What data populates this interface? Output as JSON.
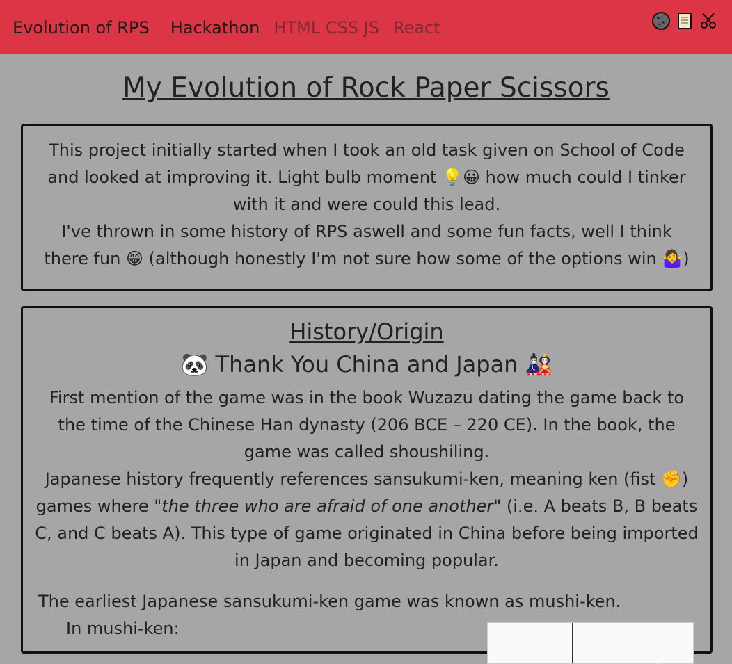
{
  "navbar": {
    "brand": "Evolution of RPS",
    "links": [
      "Hackathon",
      "HTML CSS JS",
      "React"
    ],
    "icons": [
      "rock-icon",
      "paper-icon",
      "scissors-icon"
    ]
  },
  "title": "My Evolution of Rock Paper Scissors",
  "intro": {
    "line1": "This project initially started when I took an old task given on School of Code and looked at improving it. Light bulb moment 💡😀 how much could I tinker with it and were could this lead.",
    "line2": "I've thrown in some history of RPS aswell and some fun facts, well I think there fun 😁 (although honestly I'm not sure how some of the options win 🤷‍♀️)"
  },
  "history": {
    "heading": "History/Origin",
    "subheading": "🐼 Thank You China and Japan 🎎",
    "para1": "First mention of the game was in the book Wuzazu dating the game back to the time of the Chinese Han dynasty (206 BCE – 220 CE). In the book, the game was called shoushiling.",
    "para2_before": "Japanese history frequently references sansukumi-ken, meaning ken (fist ✊) games where \"",
    "para2_italic": "the three who are afraid of one another",
    "para2_after": "\" (i.e. A beats B, B beats C, and C beats A). This type of game originated in China before being imported in Japan and becoming popular.",
    "para3": "The earliest Japanese sansukumi-ken game was known as mushi-ken.",
    "para4": "In mushi-ken:"
  }
}
